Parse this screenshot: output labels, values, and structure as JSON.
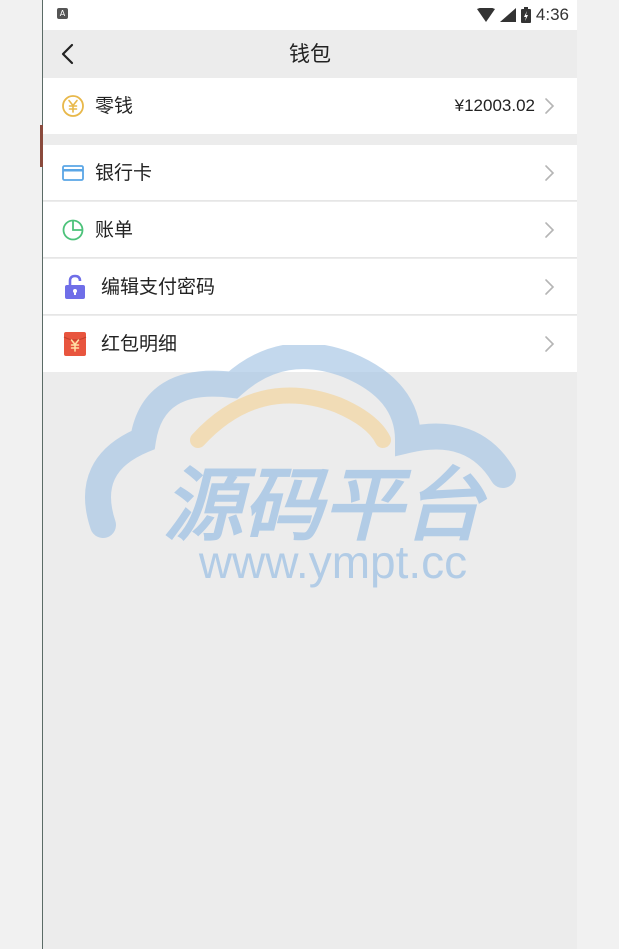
{
  "status_bar": {
    "time": "4:36",
    "icons": [
      "notification-a-icon",
      "wifi-icon",
      "signal-icon",
      "battery-charging-icon"
    ]
  },
  "nav": {
    "title": "钱包",
    "back_icon": "chevron-left-icon"
  },
  "wallet": {
    "change": {
      "label": "零钱",
      "amount": "¥12003.02",
      "icon": "yuan-coin-icon"
    }
  },
  "menu": [
    {
      "label": "银行卡",
      "icon": "bank-card-icon"
    },
    {
      "label": "账单",
      "icon": "pie-chart-icon"
    },
    {
      "label": "编辑支付密码",
      "icon": "lock-icon"
    },
    {
      "label": "红包明细",
      "icon": "red-envelope-icon"
    }
  ],
  "watermark": {
    "title": "源码平台",
    "url": "www.ympt.cc"
  },
  "colors": {
    "accent_blue": "#5aa6e6",
    "coin_yellow": "#e8b84a",
    "chart_green": "#4cc27a",
    "lock_purple": "#6f6ee8",
    "envelope_red": "#e8553e",
    "watermark_blue": "#a9c7e6",
    "watermark_orange": "#f2d9ad"
  }
}
